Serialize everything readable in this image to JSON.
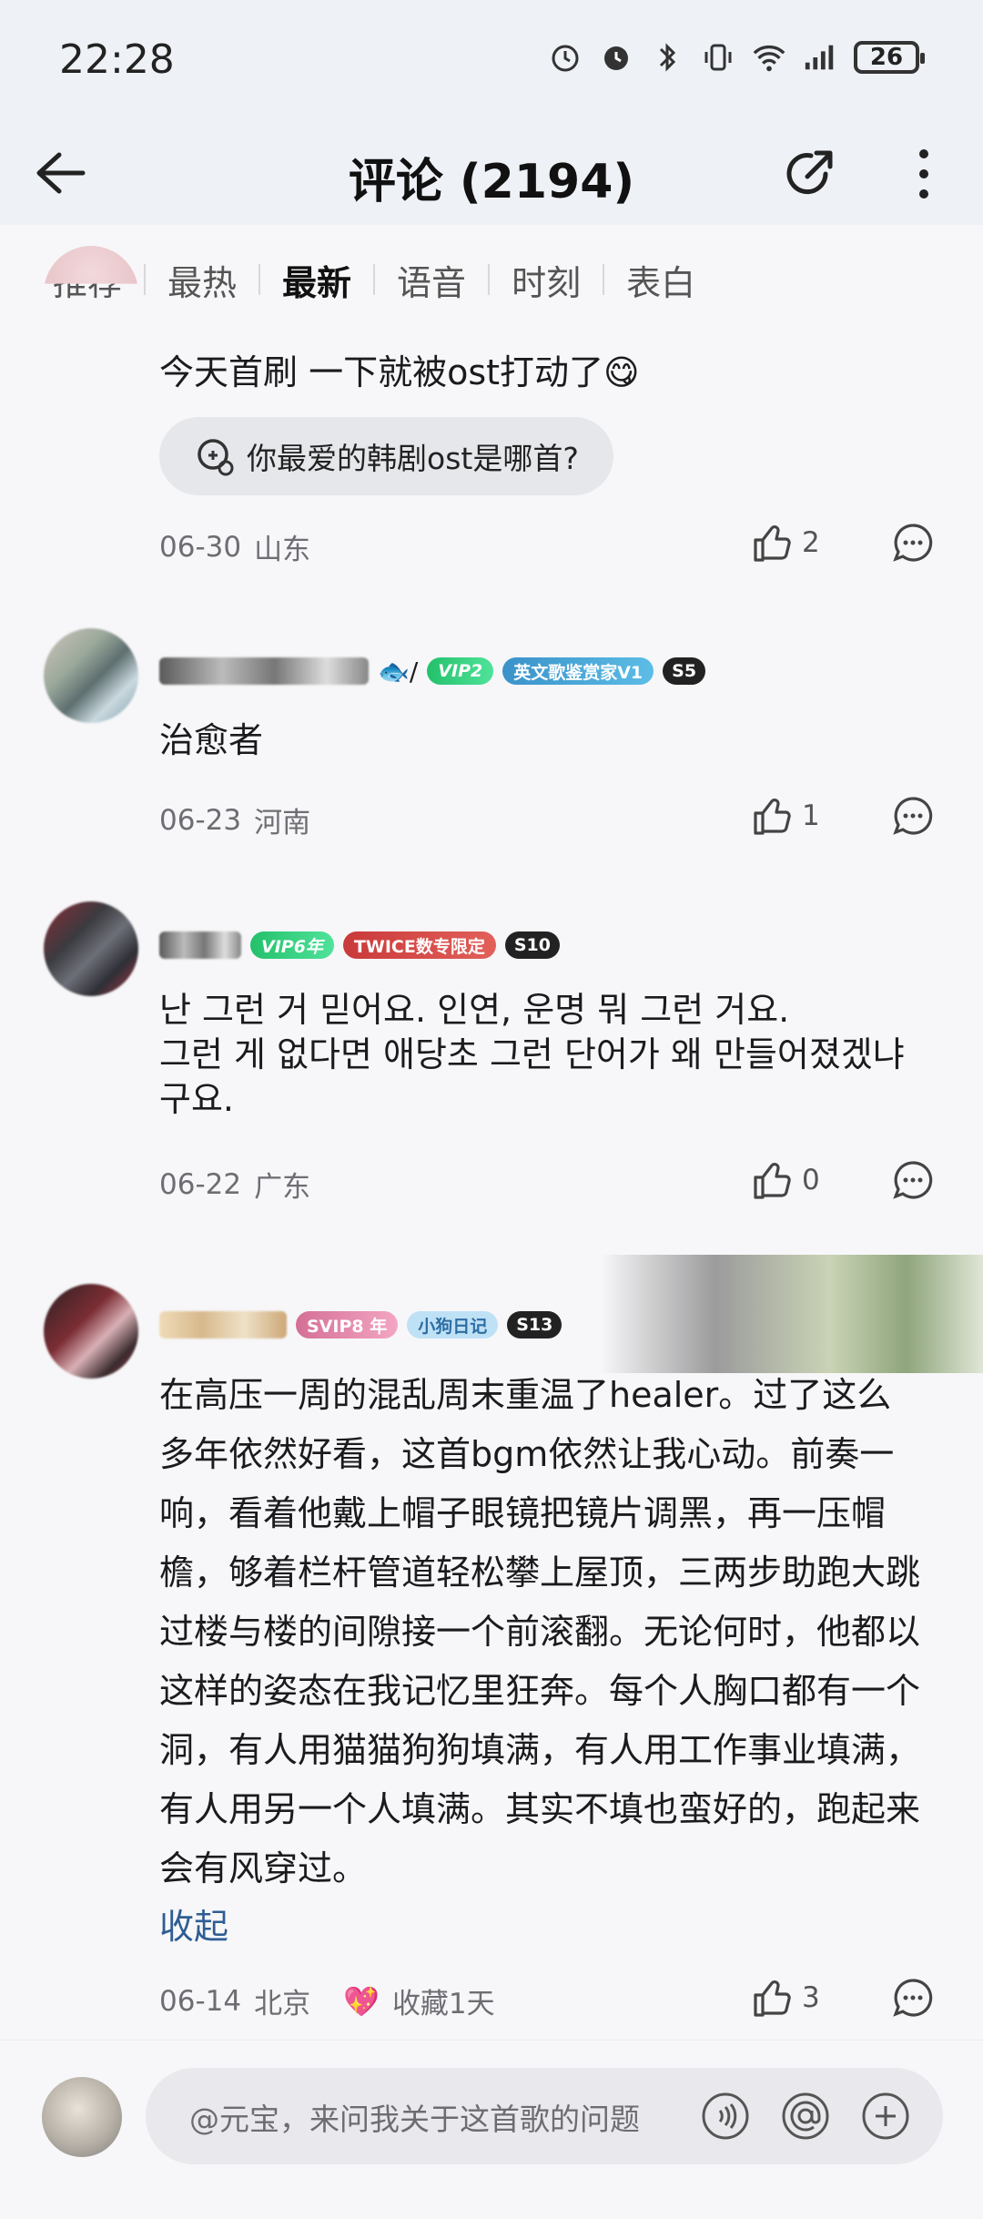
{
  "status_bar": {
    "time": "22:28",
    "battery": "26"
  },
  "header": {
    "title": "评论 (2194)"
  },
  "tabs": [
    {
      "label": "推荐"
    },
    {
      "label": "最热"
    },
    {
      "label": "最新"
    },
    {
      "label": "语音"
    },
    {
      "label": "时刻"
    },
    {
      "label": "表白"
    }
  ],
  "active_tab": "最新",
  "comments": [
    {
      "text": "今天首刷 一下就被ost打动了😋",
      "topic": "你最爱的韩剧ost是哪首?",
      "date": "06-30",
      "location": "山东",
      "likes": "2"
    },
    {
      "badges": [
        "VIP2",
        "英文歌鉴赏家V1",
        "S5"
      ],
      "text": "治愈者",
      "date": "06-23",
      "location": "河南",
      "likes": "1"
    },
    {
      "badges": [
        "VIP6年",
        "TWICE数专限定",
        "S10"
      ],
      "text": "난 그런 거 믿어요. 인연, 운명 뭐 그런 거요.\n그런 게 없다면 애당초 그런 단어가 왜 만들어졌겠냐구요.",
      "date": "06-22",
      "location": "广东",
      "likes": "0"
    },
    {
      "badges": [
        "SVIP8 年",
        "小狗日记",
        "S13"
      ],
      "text": "在高压一周的混乱周末重温了healer。过了这么多年依然好看，这首bgm依然让我心动。前奏一响，看着他戴上帽子眼镜把镜片调黑，再一压帽檐，够着栏杆管道轻松攀上屋顶，三两步助跑大跳过楼与楼的间隙接一个前滚翻。无论何时，他都以这样的姿态在我记忆里狂奔。每个人胸口都有一个洞，有人用猫猫狗狗填满，有人用工作事业填满，有人用另一个人填满。其实不填也蛮好的，跑起来会有风穿过。",
      "collapse": "收起",
      "date": "06-14",
      "location": "北京",
      "collect": "收藏1天",
      "likes": "3"
    }
  ],
  "bottom": {
    "placeholder": "@元宝，来问我关于这首歌的问题"
  },
  "colors": {
    "accent_link": "#2f5d94",
    "vip_green": "#24c06b"
  }
}
